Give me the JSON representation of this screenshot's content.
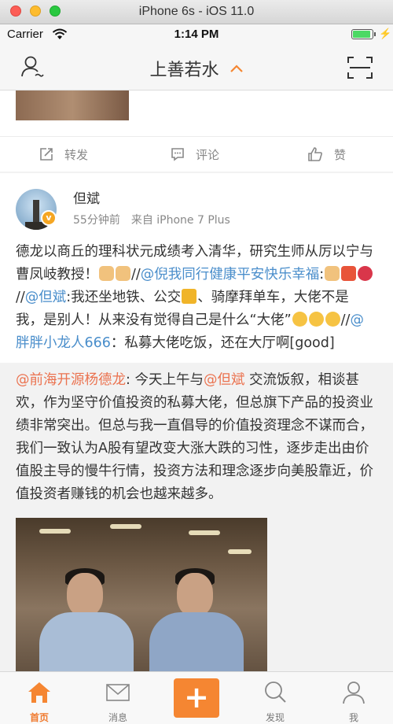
{
  "window": {
    "title": "iPhone 6s - iOS 11.0"
  },
  "status_bar": {
    "carrier": "Carrier",
    "time": "1:14 PM",
    "battery_level": 0.9
  },
  "navbar": {
    "title": "上善若水"
  },
  "prev_post": {
    "actions": {
      "forward": "转发",
      "comment": "评论",
      "like": "赞"
    }
  },
  "post": {
    "author": "但斌",
    "time": "55分钟前",
    "source": "来自 iPhone 7 Plus",
    "text": {
      "p1": "德龙以商丘的理科状元成绩考入清华，研究生师从厉以宁与曹凤岐教授！",
      "sep1": "//",
      "m1": "@倪我同行健康平安快乐幸福",
      "p2": ":",
      "sep2": "//",
      "m2": "@但斌",
      "p3": ":我还坐地铁、公交",
      "p4": "、骑摩拜单车，大佬不是我，是别人！从来没有觉得自己是什么“大佬”",
      "sep3": "//",
      "m3": "@胖胖小龙人666",
      "p5": "：私募大佬吃饭，还在大厅啊[good]"
    },
    "repost": {
      "m1": "@前海开源杨德龙",
      "p1": ": 今天上午与",
      "m2": "@但斌",
      "p2": " 交流饭叙，相谈甚欢，作为坚守价值投资的私募大佬，但总旗下产品的投资业绩非常突出。但总与我一直倡导的价值投资理念不谋而合，我们一致认为A股有望改变大涨大跌的习性，逐步走出由价值股主导的慢牛行情，投资方法和理念逐步向美股靠近，价值投资者赚钱的机会也越来越多。"
    }
  },
  "tabbar": {
    "home": "首页",
    "messages": "消息",
    "discover": "发现",
    "me": "我"
  },
  "colors": {
    "accent": "#f58632",
    "link": "#4a8ecb",
    "mention_orange": "#eb7350"
  }
}
